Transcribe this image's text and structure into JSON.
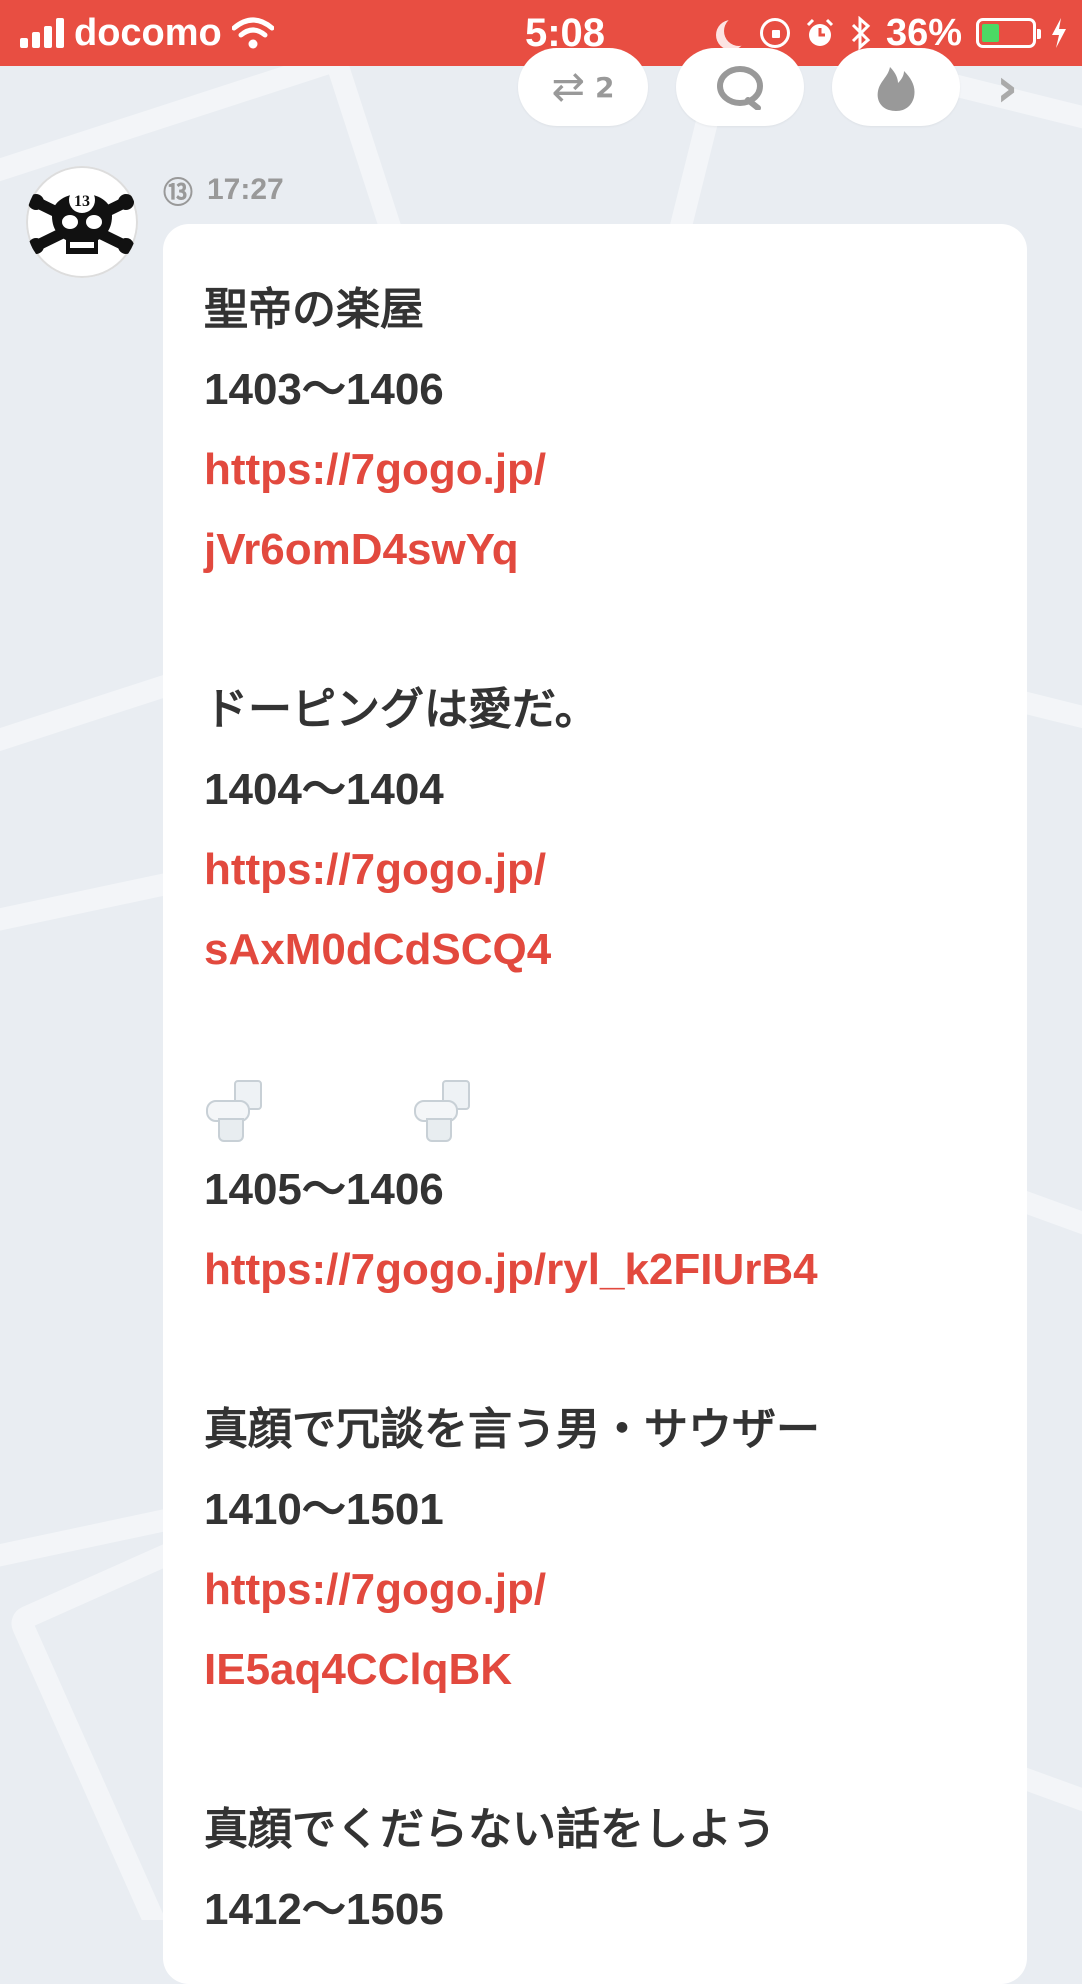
{
  "status_bar": {
    "carrier": "docomo",
    "time": "5:08",
    "battery_percent": "36%",
    "battery_level": 0.36
  },
  "actions": {
    "repost_count": "2",
    "repost_icon": "repost-icon",
    "comment_icon": "comment-icon",
    "fire_icon": "fire-icon",
    "more_icon": "chevron-right-icon"
  },
  "post": {
    "badge": "⑬",
    "time": "17:27",
    "lines": [
      {
        "text": "聖帝の楽屋",
        "type": "text"
      },
      {
        "text": "1403〜1406",
        "type": "text"
      },
      {
        "text": "https://7gogo.jp/",
        "type": "link"
      },
      {
        "text": "jVr6omD4swYq",
        "type": "link"
      },
      {
        "text": "",
        "type": "blank"
      },
      {
        "text": "ドーピングは愛だ。",
        "type": "text"
      },
      {
        "text": "1404〜1404",
        "type": "text"
      },
      {
        "text": "https://7gogo.jp/",
        "type": "link"
      },
      {
        "text": "sAxM0dCdSCQ4",
        "type": "link"
      },
      {
        "text": "",
        "type": "blank"
      },
      {
        "text": "",
        "type": "emoji"
      },
      {
        "text": "1405〜1406",
        "type": "text"
      },
      {
        "text": "https://7gogo.jp/ryl_k2FIUrB4",
        "type": "link"
      },
      {
        "text": "",
        "type": "blank"
      },
      {
        "text": "真顔で冗談を言う男・サウザー",
        "type": "text"
      },
      {
        "text": "1410〜1501",
        "type": "text"
      },
      {
        "text": "https://7gogo.jp/",
        "type": "link"
      },
      {
        "text": "IE5aq4CClqBK",
        "type": "link"
      },
      {
        "text": "",
        "type": "blank"
      },
      {
        "text": "真顔でくだらない話をしよう",
        "type": "text"
      },
      {
        "text": "1412〜1505",
        "type": "text"
      }
    ]
  },
  "colors": {
    "status_bar": "#e84e42",
    "link": "#e2493e",
    "background": "#e9edf2"
  }
}
